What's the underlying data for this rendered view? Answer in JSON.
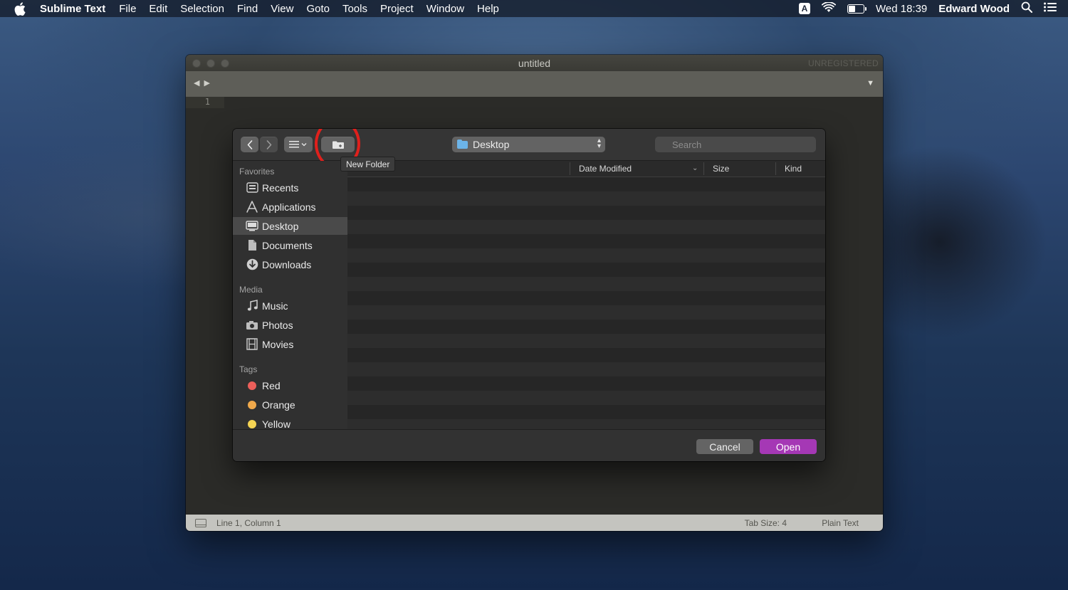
{
  "menubar": {
    "app_name": "Sublime Text",
    "items": [
      "File",
      "Edit",
      "Selection",
      "Find",
      "View",
      "Goto",
      "Tools",
      "Project",
      "Window",
      "Help"
    ],
    "input_badge": "A",
    "clock": "Wed 18:39",
    "user": "Edward Wood",
    "icons": [
      "apple-icon",
      "wifi-icon",
      "battery-icon",
      "search-icon",
      "list-icon"
    ]
  },
  "sublime_window": {
    "title": "untitled",
    "registration": "UNREGISTERED",
    "line_number": "1",
    "status": {
      "position": "Line 1, Column 1",
      "tab_size": "Tab Size: 4",
      "syntax": "Plain Text"
    }
  },
  "open_dialog": {
    "location": "Desktop",
    "search_placeholder": "Search",
    "tooltip": "New Folder",
    "columns": {
      "date_modified": "Date Modified",
      "size": "Size",
      "kind": "Kind"
    },
    "sidebar": {
      "favorites_label": "Favorites",
      "favorites": [
        {
          "label": "Recents",
          "icon": "recents-icon"
        },
        {
          "label": "Applications",
          "icon": "applications-icon"
        },
        {
          "label": "Desktop",
          "icon": "desktop-icon",
          "selected": true
        },
        {
          "label": "Documents",
          "icon": "documents-icon"
        },
        {
          "label": "Downloads",
          "icon": "downloads-icon"
        }
      ],
      "media_label": "Media",
      "media": [
        {
          "label": "Music",
          "icon": "music-icon"
        },
        {
          "label": "Photos",
          "icon": "photos-icon"
        },
        {
          "label": "Movies",
          "icon": "movies-icon"
        }
      ],
      "tags_label": "Tags",
      "tags": [
        {
          "label": "Red",
          "color": "#ec5f5a"
        },
        {
          "label": "Orange",
          "color": "#f0a94b"
        },
        {
          "label": "Yellow",
          "color": "#f5d453"
        }
      ]
    },
    "buttons": {
      "cancel": "Cancel",
      "open": "Open"
    },
    "accent_color": "#a538b5",
    "highlight_ring_color": "#e0201c"
  }
}
